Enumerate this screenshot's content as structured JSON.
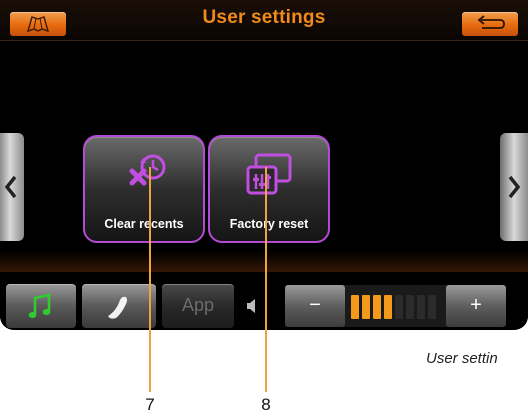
{
  "header": {
    "title": "User settings",
    "map_icon": "map-icon",
    "back_icon": "back-arrow-icon",
    "accent_color": "#e86a0e",
    "title_color": "#f08a1c"
  },
  "tiles": [
    {
      "label": "Clear recents",
      "icon": "clear-recents-icon"
    },
    {
      "label": "Factory reset",
      "icon": "factory-reset-icon"
    }
  ],
  "tile_border_color": "#b24ad2",
  "nav": {
    "prev_icon": "chevron-left-icon",
    "next_icon": "chevron-right-icon"
  },
  "bottom_bar": {
    "music_icon": "music-note-icon",
    "phone_icon": "phone-icon",
    "app_label": "App",
    "speaker_icon": "speaker-icon",
    "volume_minus": "−",
    "volume_plus": "+",
    "volume_level": 4,
    "volume_max": 8
  },
  "annotations": {
    "callout_1": "7",
    "callout_2": "8",
    "caption": "User settin"
  }
}
